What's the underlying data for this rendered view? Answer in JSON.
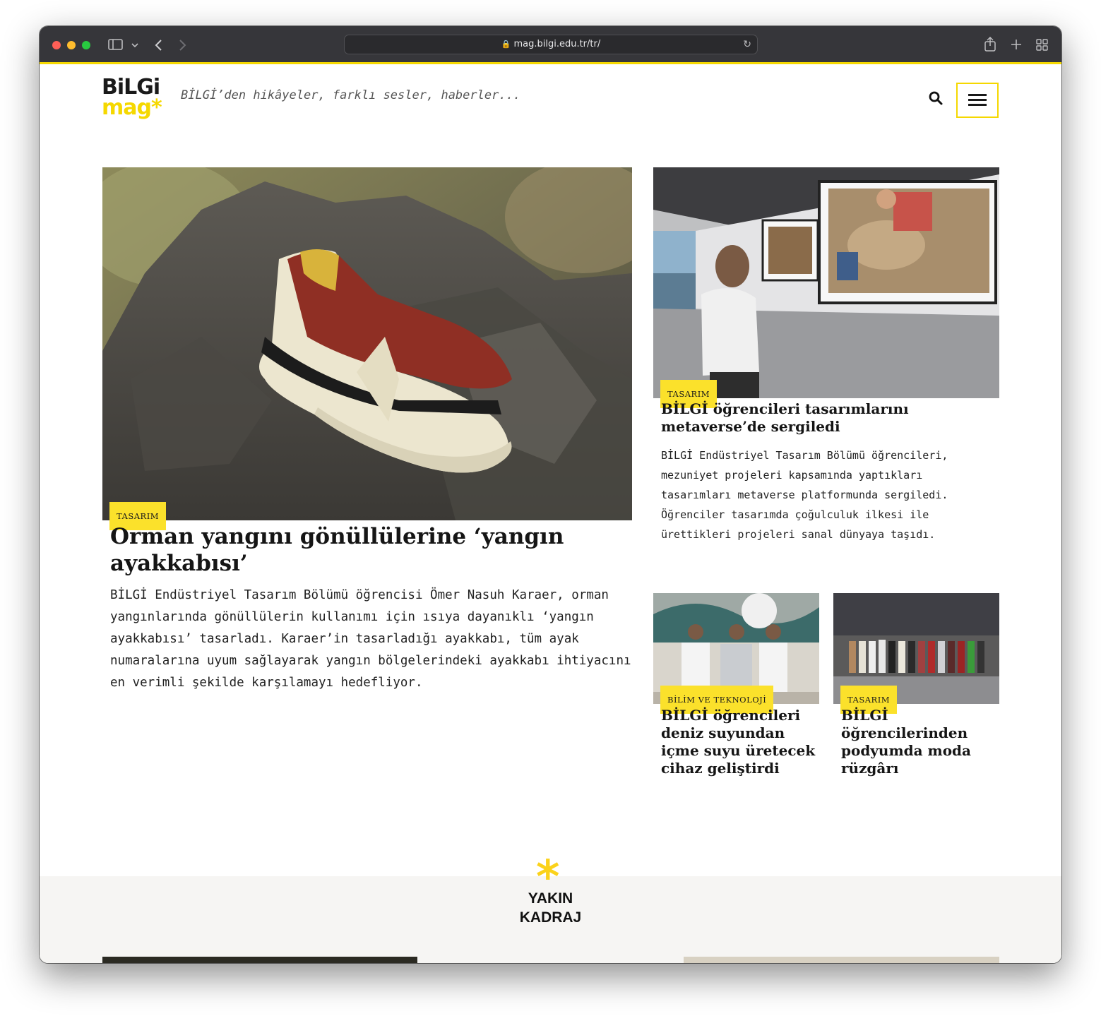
{
  "browser": {
    "url": "mag.bilgi.edu.tr/tr/"
  },
  "header": {
    "logo_line1": "BiLGi",
    "logo_line2": "mag*",
    "tagline": "BİLGİ’den hikâyeler, farklı sesler, haberler..."
  },
  "featured": {
    "tag": "TASARIM",
    "title": "Orman yangını gönüllülerine ‘yangın ayakkabısı’",
    "summary": "BİLGİ Endüstriyel Tasarım Bölümü öğrencisi Ömer Nasuh Karaer, orman yangınlarında gönüllülerin kullanımı için ısıya dayanıklı ‘yangın ayakkabısı’ tasarladı. Karaer’in tasarladığı ayakkabı, tüm ayak numaralarına uyum sağlayarak yangın bölgelerindeki ayakkabı ihtiyacını en verimli şekilde karşılamayı hedefliyor."
  },
  "secondary": {
    "tag": "TASARIM",
    "title": "BİLGİ öğrencileri tasarımlarını metaverse’de sergiledi",
    "summary": "BİLGİ Endüstriyel Tasarım Bölümü öğrencileri, mezuniyet projeleri kapsamında yaptıkları tasarımları metaverse platformunda sergiledi. Öğrenciler tasarımda çoğulculuk ilkesi ile ürettikleri projeleri sanal dünyaya taşıdı."
  },
  "small_cards": [
    {
      "tag": "BİLİM VE TEKNOLOJİ",
      "title": "BİLGİ öğrencileri deniz suyundan içme suyu üretecek cihaz geliştirdi"
    },
    {
      "tag": "TASARIM",
      "title": "BİLGİ öğrencilerinden podyumda moda rüzgârı"
    }
  ],
  "section": {
    "title_line1": "YAKIN",
    "title_line2": "KADRAJ"
  },
  "colors": {
    "accent_yellow": "#fbe12b",
    "text_dark": "#151515"
  }
}
